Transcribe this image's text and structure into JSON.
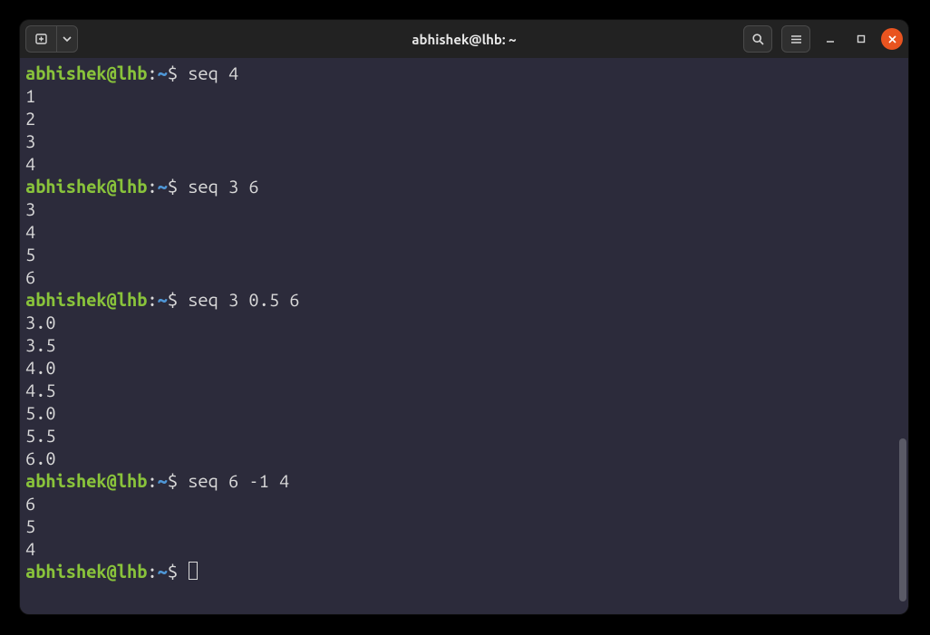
{
  "window": {
    "title": "abhishek@lhb: ~"
  },
  "prompt": {
    "user_host": "abhishek@lhb",
    "sep1": ":",
    "path": "~",
    "sep2": "$"
  },
  "session": [
    {
      "cmd": "seq 4",
      "out": [
        "1",
        "2",
        "3",
        "4"
      ]
    },
    {
      "cmd": "seq 3 6",
      "out": [
        "3",
        "4",
        "5",
        "6"
      ]
    },
    {
      "cmd": "seq 3 0.5 6",
      "out": [
        "3.0",
        "3.5",
        "4.0",
        "4.5",
        "5.0",
        "5.5",
        "6.0"
      ]
    },
    {
      "cmd": "seq 6 -1 4",
      "out": [
        "6",
        "5",
        "4"
      ]
    }
  ],
  "icons": {
    "new_tab": "new-tab-icon",
    "dropdown": "chevron-down-icon",
    "search": "search-icon",
    "menu": "hamburger-icon",
    "minimize": "minimize-icon",
    "maximize": "maximize-icon",
    "close": "close-icon"
  }
}
